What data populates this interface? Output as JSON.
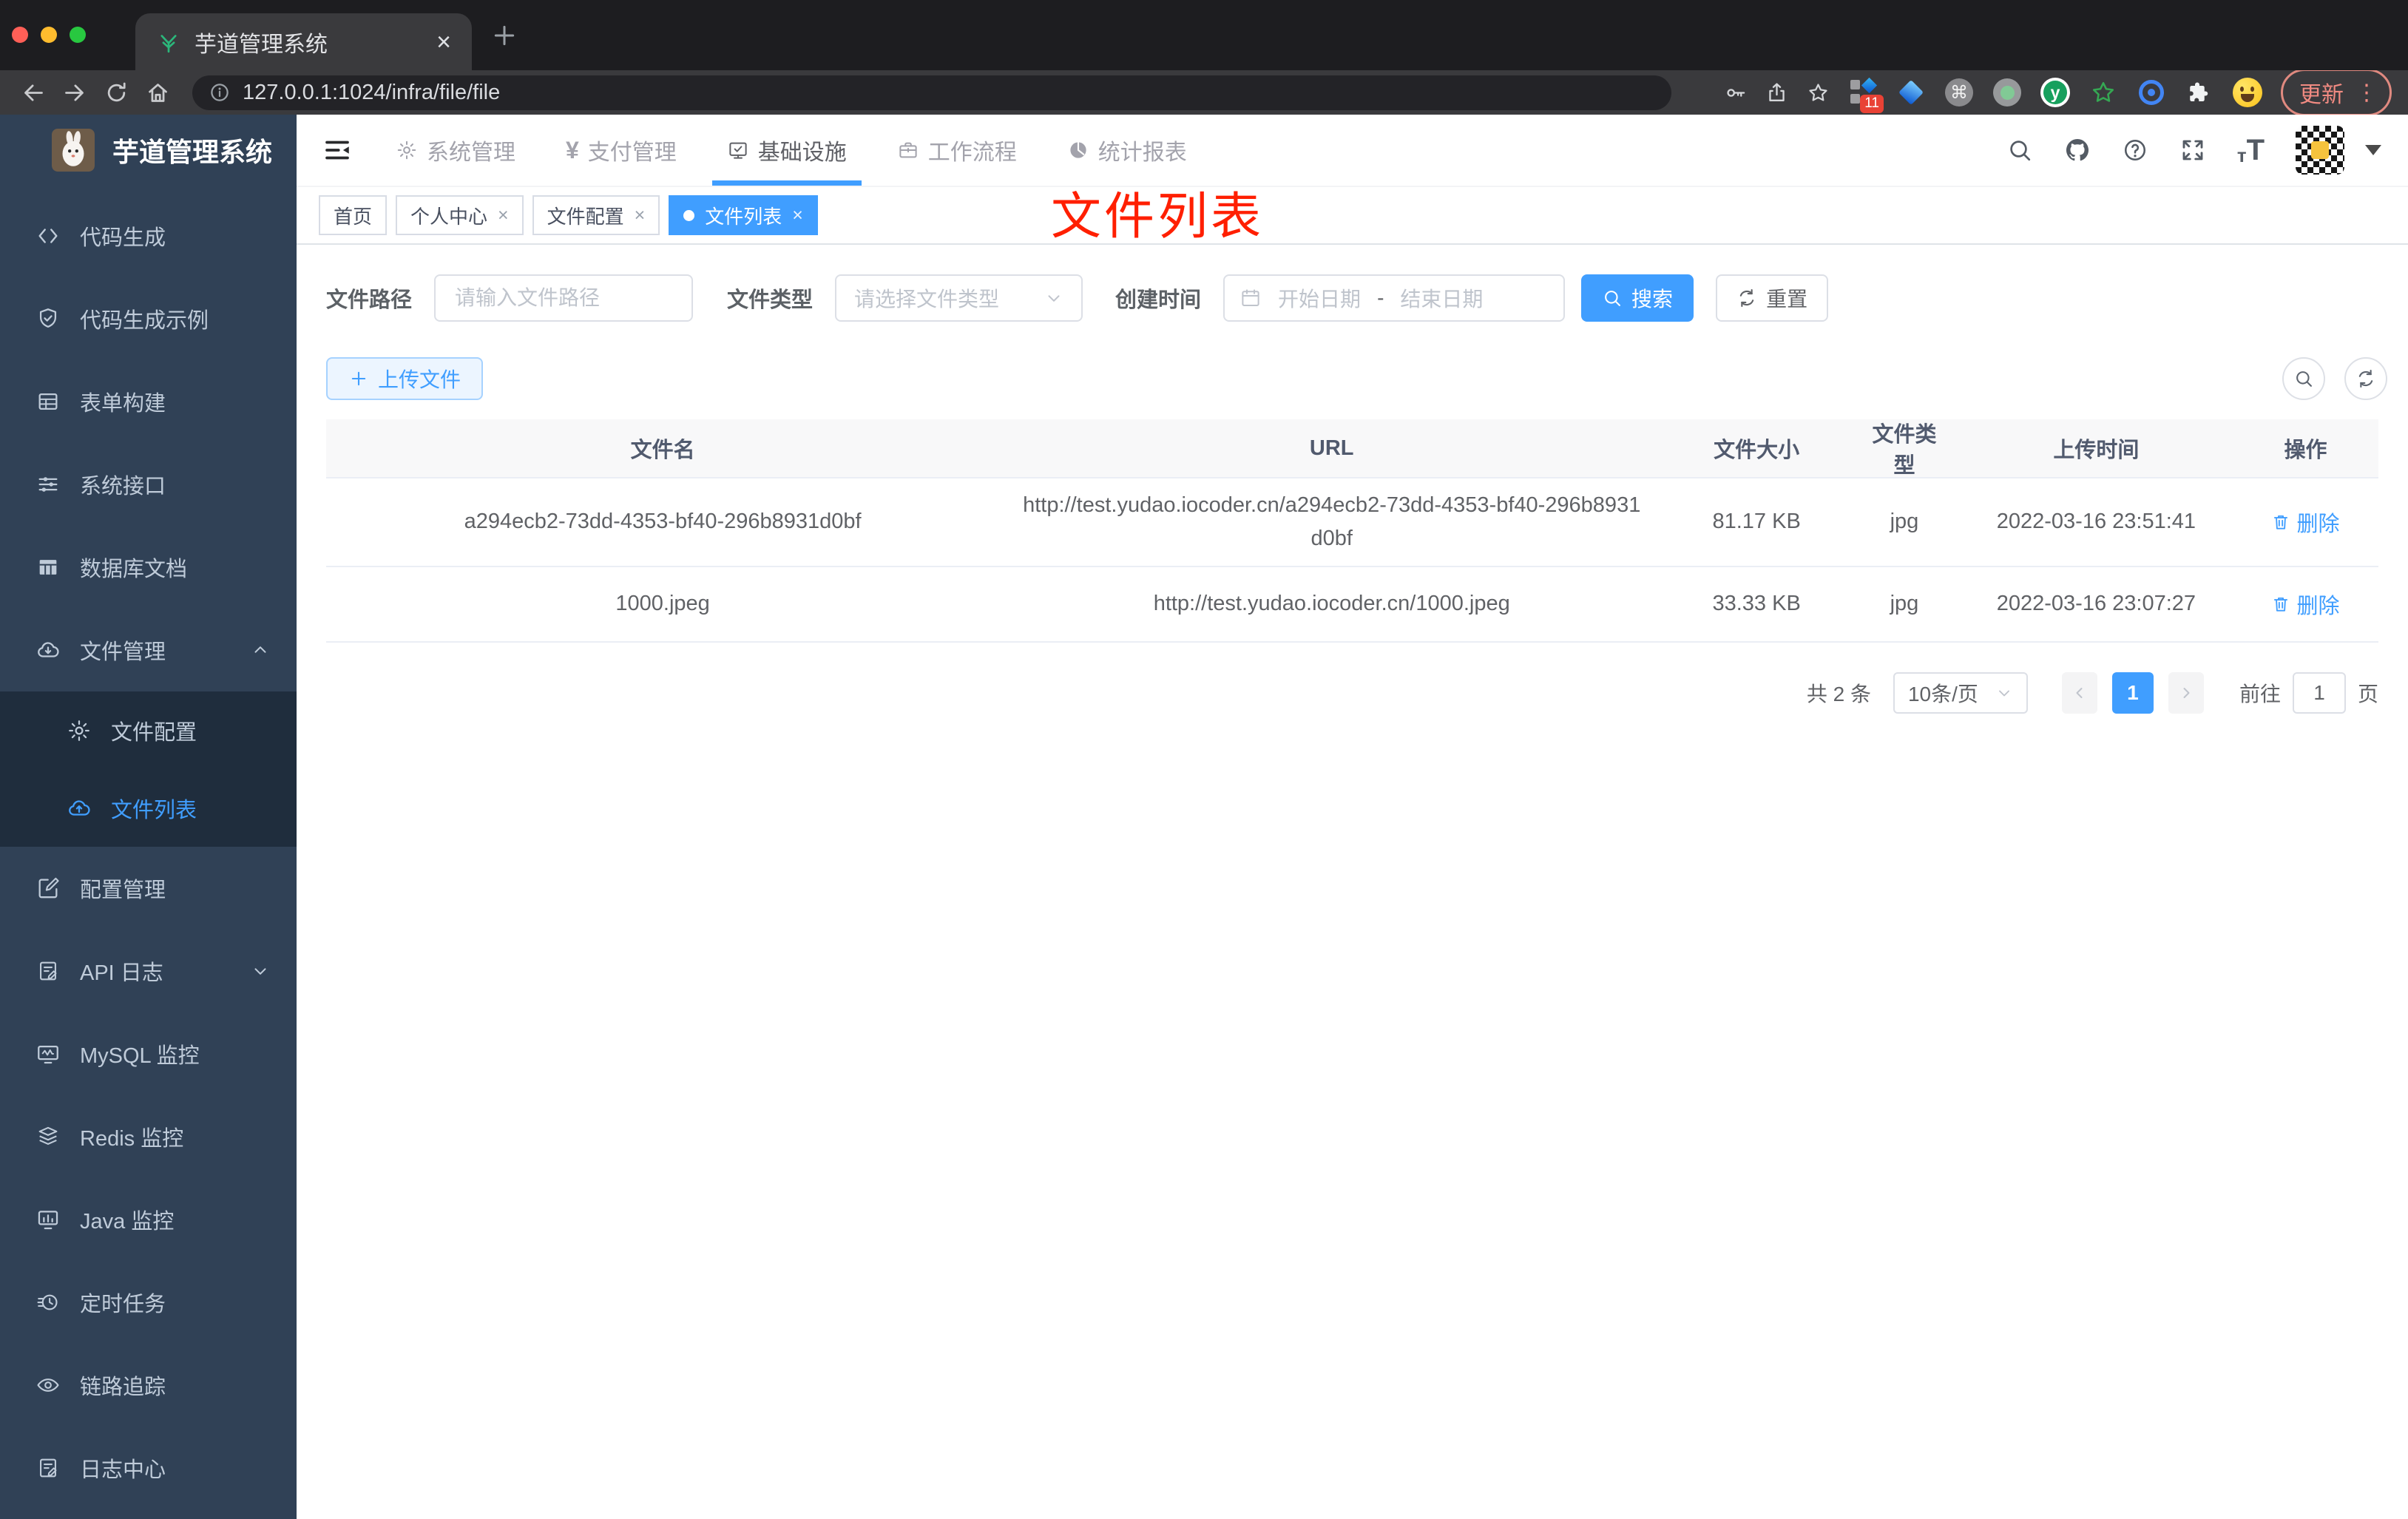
{
  "browser": {
    "tab_title": "芋道管理系统",
    "url": "127.0.0.1:1024/infra/file/file",
    "update_label": "更新",
    "extension_badge": "11",
    "kebab": "⋮"
  },
  "colors": {
    "accent": "#409eff",
    "sidebar_bg": "#304156",
    "submenu_bg": "#1f2d3d",
    "annotation_red": "#ff1f00",
    "table_header_bg": "#f8f8f9"
  },
  "icons": {
    "browser": [
      "back-icon",
      "forward-icon",
      "reload-icon",
      "home-icon",
      "info-icon",
      "key-icon",
      "share-icon",
      "star-icon",
      "puzzle-icon"
    ],
    "header": [
      "hamburger-icon",
      "search-icon",
      "github-icon",
      "help-icon",
      "fullscreen-icon",
      "font-size-icon"
    ],
    "actions": [
      "plus-icon",
      "magnifier-icon",
      "refresh-icon",
      "calendar-icon",
      "trash-icon"
    ]
  },
  "sidebar": {
    "title": "芋道管理系统",
    "items": [
      {
        "label": "代码生成"
      },
      {
        "label": "代码生成示例"
      },
      {
        "label": "表单构建"
      },
      {
        "label": "系统接口"
      },
      {
        "label": "数据库文档"
      },
      {
        "label": "文件管理"
      },
      {
        "label": "文件配置"
      },
      {
        "label": "文件列表"
      },
      {
        "label": "配置管理"
      },
      {
        "label": "API 日志"
      },
      {
        "label": "MySQL 监控"
      },
      {
        "label": "Redis 监控"
      },
      {
        "label": "Java 监控"
      },
      {
        "label": "定时任务"
      },
      {
        "label": "链路追踪"
      },
      {
        "label": "日志中心"
      }
    ]
  },
  "topnav": {
    "items": [
      {
        "label": "系统管理"
      },
      {
        "label": "支付管理",
        "glyph": "¥"
      },
      {
        "label": "基础设施"
      },
      {
        "label": "工作流程"
      },
      {
        "label": "统计报表"
      }
    ]
  },
  "tabs": [
    {
      "label": "首页"
    },
    {
      "label": "个人中心",
      "close": "×"
    },
    {
      "label": "文件配置",
      "close": "×"
    },
    {
      "label": "文件列表",
      "close": "×"
    }
  ],
  "annotation": "文件列表",
  "filters": {
    "path_label": "文件路径",
    "path_placeholder": "请输入文件路径",
    "type_label": "文件类型",
    "type_placeholder": "请选择文件类型",
    "date_label": "创建时间",
    "date_start": "开始日期",
    "date_sep": "-",
    "date_end": "结束日期",
    "search": "搜索",
    "reset": "重置"
  },
  "toolbar": {
    "upload": "上传文件"
  },
  "table": {
    "headers": [
      "文件名",
      "URL",
      "文件大小",
      "文件类型",
      "上传时间",
      "操作"
    ],
    "rows": [
      {
        "name": "a294ecb2-73dd-4353-bf40-296b8931d0bf",
        "url": "http://test.yudao.iocoder.cn/a294ecb2-73dd-4353-bf40-296b8931d0bf",
        "size": "81.17 KB",
        "type": "jpg",
        "time": "2022-03-16 23:51:41",
        "action": "删除"
      },
      {
        "name": "1000.jpeg",
        "url": "http://test.yudao.iocoder.cn/1000.jpeg",
        "size": "33.33 KB",
        "type": "jpg",
        "time": "2022-03-16 23:07:27",
        "action": "删除"
      }
    ]
  },
  "pagination": {
    "total": "共 2 条",
    "page_size": "10条/页",
    "current": "1",
    "goto_label": "前往",
    "goto_value": "1",
    "unit": "页"
  }
}
